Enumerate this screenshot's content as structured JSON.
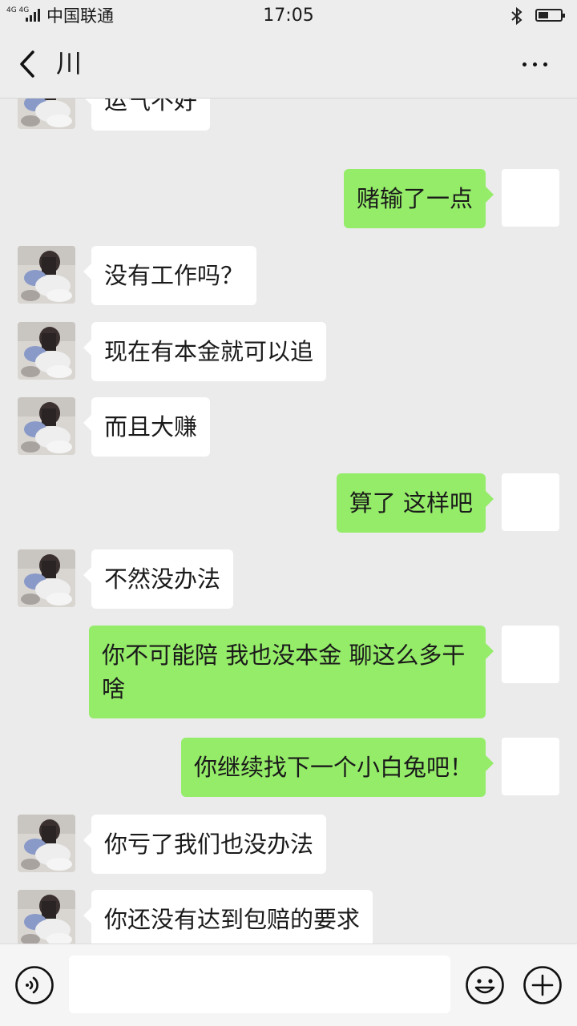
{
  "status_bar": {
    "network": "4G 4G",
    "carrier": "中国联通",
    "time": "17:05",
    "battery_level": 0.45
  },
  "header": {
    "back_icon": "chevron-left-icon",
    "title": "川",
    "more_icon": "more-dots-icon"
  },
  "messages": [
    {
      "side": "left",
      "text": "运气不好"
    },
    {
      "side": "right",
      "text": "赌输了一点"
    },
    {
      "side": "left",
      "text": "没有工作吗？"
    },
    {
      "side": "left",
      "text": "现在有本金就可以追"
    },
    {
      "side": "left",
      "text": "而且大赚"
    },
    {
      "side": "right",
      "text": "算了 这样吧"
    },
    {
      "side": "left",
      "text": "不然没办法"
    },
    {
      "side": "right",
      "text": "你不可能陪 我也没本金 聊这么多干啥"
    },
    {
      "side": "right",
      "text": "你继续找下一个小白兔吧！"
    },
    {
      "side": "left",
      "text": "你亏了我们也没办法"
    },
    {
      "side": "left",
      "text": "你还没有达到包赔的要求"
    }
  ],
  "input_bar": {
    "voice_icon": "voice-icon",
    "input_value": "",
    "emoji_icon": "emoji-icon",
    "plus_icon": "plus-icon"
  },
  "colors": {
    "background": "#ebebeb",
    "sent_bubble": "#95ec69",
    "received_bubble": "#ffffff"
  }
}
